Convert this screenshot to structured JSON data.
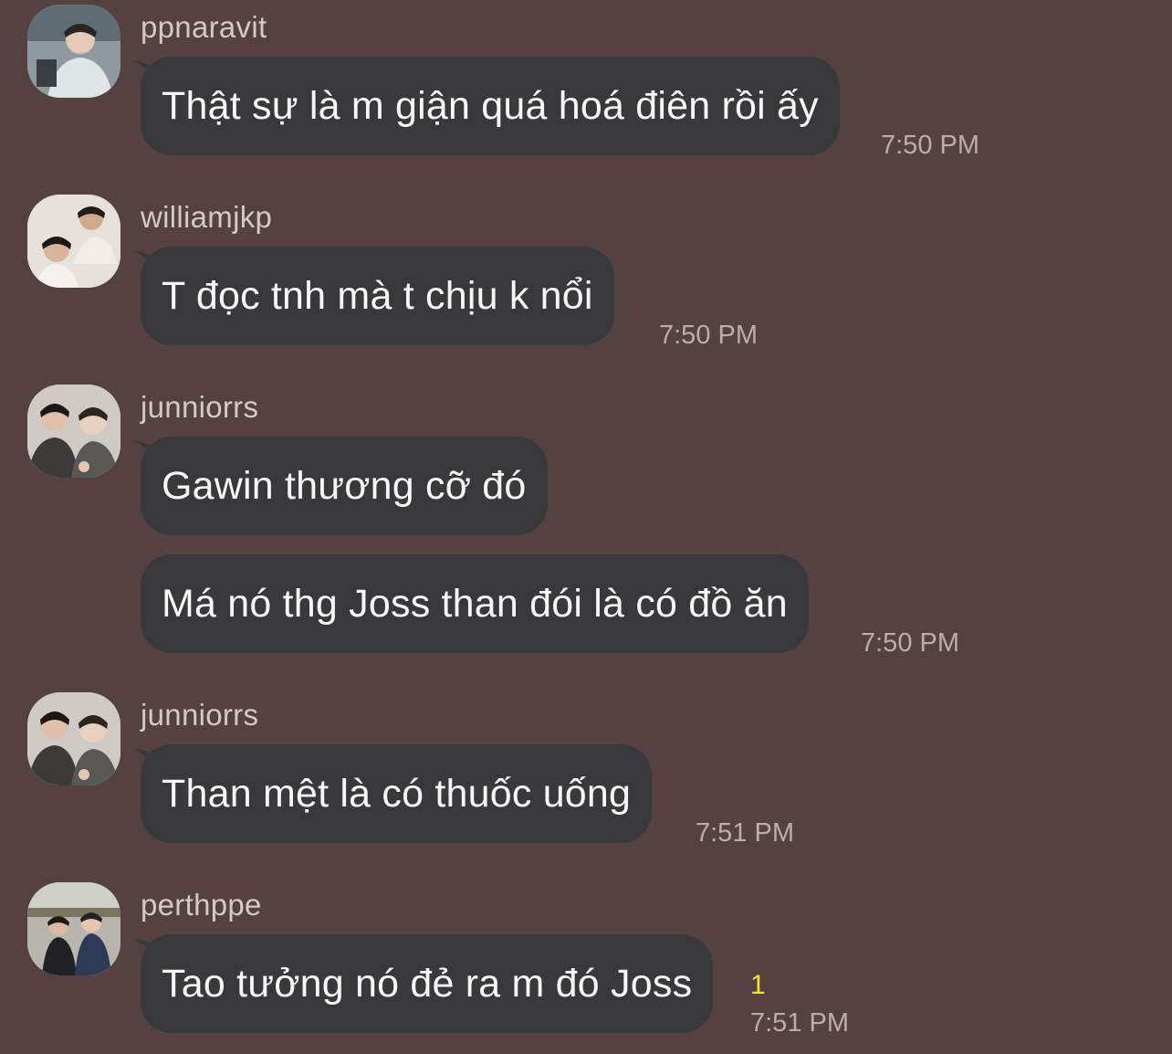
{
  "chat": {
    "messages": [
      {
        "username": "ppnaravit",
        "text": "Thật sự là m giận quá hoá điên rồi ấy",
        "time": "7:50 PM",
        "avatar_icon": "user-avatar-icon"
      },
      {
        "username": "williamjkp",
        "text": "T đọc tnh mà t chịu k nổi",
        "time": "7:50 PM",
        "avatar_icon": "user-avatar-icon"
      },
      {
        "username": "junniorrs",
        "text": "Gawin thương cỡ đó",
        "avatar_icon": "user-avatar-icon"
      },
      {
        "text": "Má nó thg Joss than đói là có đồ ăn",
        "time": "7:50 PM"
      },
      {
        "username": "junniorrs",
        "text": "Than mệt là có thuốc uống",
        "time": "7:51 PM",
        "avatar_icon": "user-avatar-icon"
      },
      {
        "username": "perthppe",
        "text": "Tao tưởng nó đẻ ra m đó Joss",
        "time": "7:51 PM",
        "unread_count": "1",
        "avatar_icon": "user-avatar-icon"
      }
    ]
  },
  "colors": {
    "background": "#554142",
    "bubble": "#39383a",
    "bubble_text": "#f6f6f6",
    "username": "#d3c9c9",
    "time": "#b9adad",
    "unread": "#f5e52a"
  }
}
